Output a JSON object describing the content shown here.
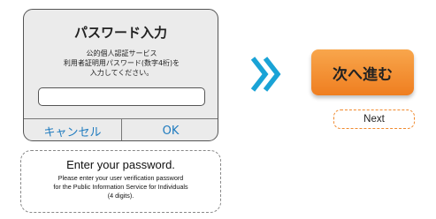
{
  "dialog": {
    "title": "パスワード入力",
    "message_lines": [
      "公的個人認証サービス",
      "利用者証明用パスワード(数字4桁)を",
      "入力してください。"
    ],
    "password_value": "",
    "cancel_label": "キャンセル",
    "ok_label": "OK"
  },
  "caption": {
    "title": "Enter your password.",
    "body_lines": [
      "Please enter your user verification password",
      "for the Public Information Service for Individuals",
      "(4 digits)."
    ]
  },
  "flow_arrow": {
    "icon": "double-chevron-right-icon",
    "color": "#1aa3d6"
  },
  "next_button": {
    "label": "次へ進む",
    "color": "#f0862a"
  },
  "next_caption": "Next"
}
